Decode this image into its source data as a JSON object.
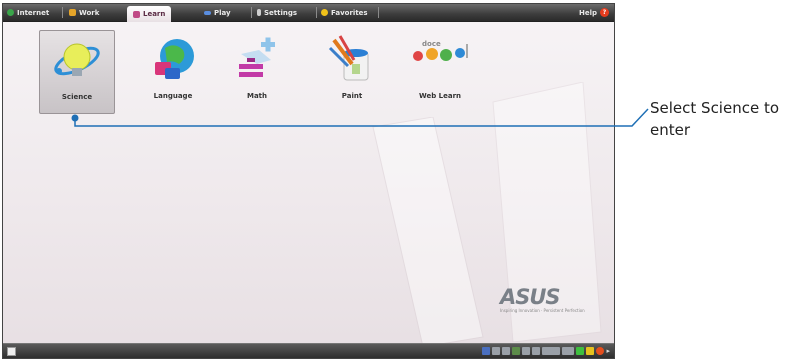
{
  "tabs": [
    {
      "label": "Internet",
      "icon": "globe-icon",
      "color": "#3aa54a"
    },
    {
      "label": "Work",
      "icon": "briefcase-icon",
      "color": "#e5a52a"
    },
    {
      "label": "Learn",
      "icon": "learn-icon",
      "color": "#c04a86",
      "active": true
    },
    {
      "label": "Play",
      "icon": "gamepad-icon",
      "color": "#5a8ee0"
    },
    {
      "label": "Settings",
      "icon": "settings-icon",
      "color": "#cfcfcf"
    },
    {
      "label": "Favorites",
      "icon": "star-icon",
      "color": "#f0c21a"
    }
  ],
  "help_label": "Help",
  "apps": [
    {
      "label": "Science",
      "icon": "science-icon",
      "selected": true
    },
    {
      "label": "Language",
      "icon": "language-globe-icon"
    },
    {
      "label": "Math",
      "icon": "math-icon"
    },
    {
      "label": "Paint",
      "icon": "paint-icon"
    },
    {
      "label": "Web Learn",
      "icon": "web-learn-icon"
    }
  ],
  "web_learn_logo_text": "doce",
  "brand": {
    "logo": "ASUS",
    "tagline": "Inspiring Innovation · Persistent Perfection"
  },
  "callout": {
    "text": "Select Science to enter",
    "color": "#1e6fb5"
  }
}
